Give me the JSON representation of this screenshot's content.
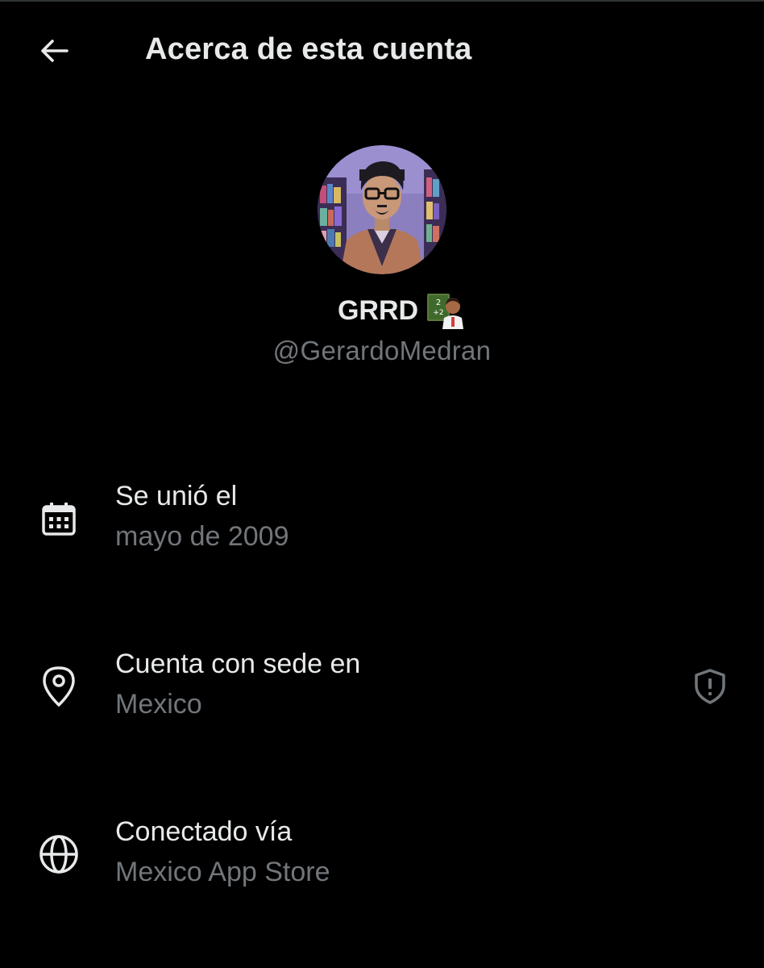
{
  "header": {
    "back_icon": "arrow-left-icon",
    "title": "Acerca de esta cuenta"
  },
  "profile": {
    "display_name": "GRRD",
    "name_emoji": "teacher-emoji",
    "handle": "@GerardoMedran"
  },
  "rows": [
    {
      "icon": "calendar-icon",
      "label": "Se unió el",
      "value": "mayo de 2009"
    },
    {
      "icon": "location-pin-icon",
      "label": "Cuenta con sede en",
      "value": "Mexico",
      "trailing_icon": "shield-alert-icon"
    },
    {
      "icon": "globe-icon",
      "label": "Conectado vía",
      "value": "Mexico App Store"
    }
  ],
  "colors": {
    "background": "#000000",
    "primary_text": "#e7e9ea",
    "secondary_text": "#71767b"
  }
}
